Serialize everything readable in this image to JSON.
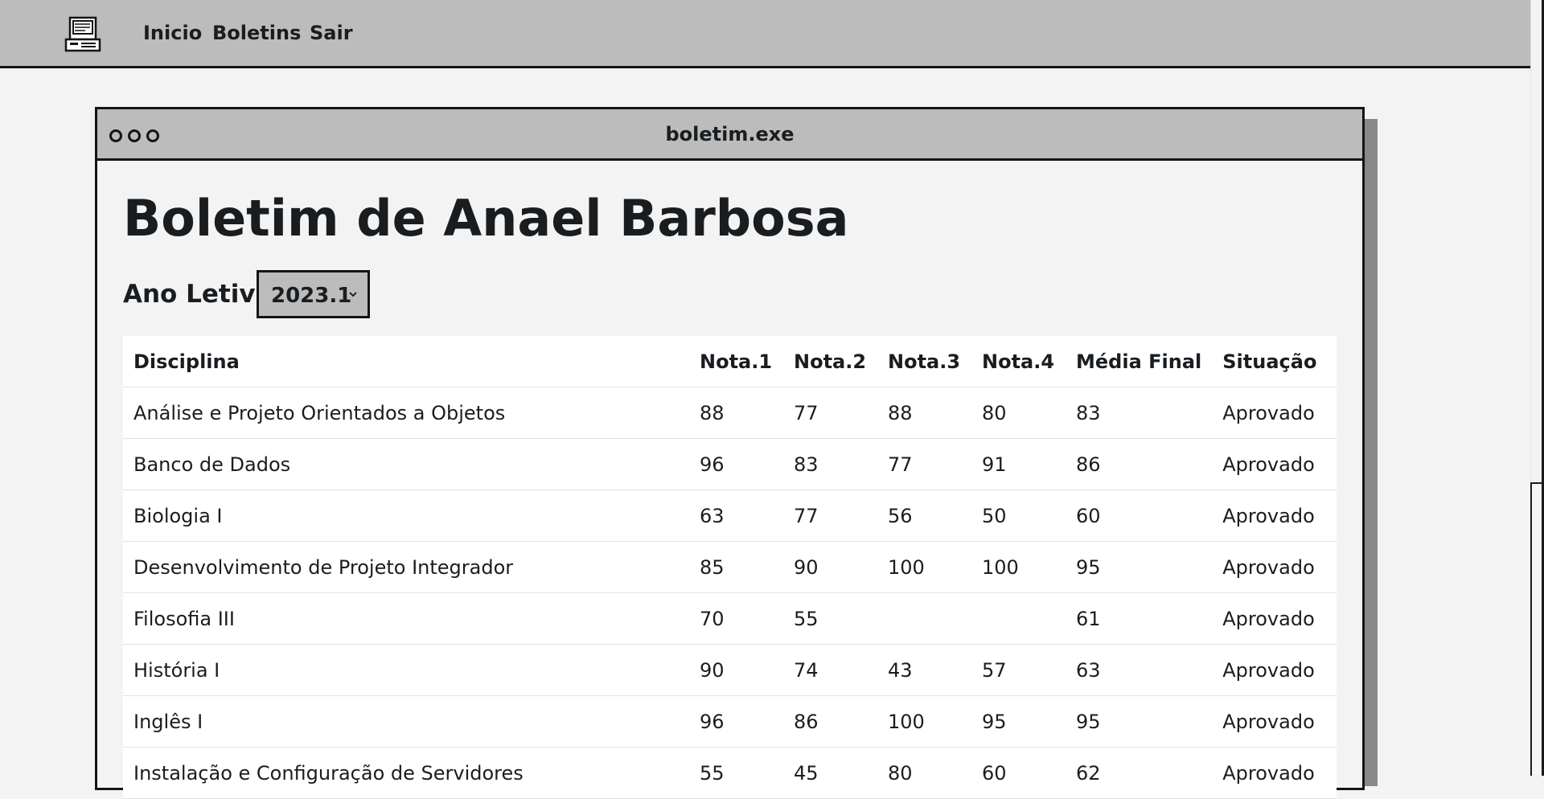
{
  "navbar": {
    "logo_icon": "retro-computer-icon",
    "links": [
      "Inicio",
      "Boletins",
      "Sair"
    ]
  },
  "window": {
    "title": "boletim.exe",
    "controls": [
      "circle-icon",
      "circle-icon",
      "circle-icon"
    ]
  },
  "page": {
    "heading": "Boletim de Anael Barbosa",
    "year_label": "Ano Letivo",
    "year_selected": "2023.1"
  },
  "table": {
    "headers": [
      "Disciplina",
      "Nota.1",
      "Nota.2",
      "Nota.3",
      "Nota.4",
      "Média Final",
      "Situação"
    ],
    "rows": [
      [
        "Análise e Projeto Orientados a Objetos",
        "88",
        "77",
        "88",
        "80",
        "83",
        "Aprovado"
      ],
      [
        "Banco de Dados",
        "96",
        "83",
        "77",
        "91",
        "86",
        "Aprovado"
      ],
      [
        "Biologia I",
        "63",
        "77",
        "56",
        "50",
        "60",
        "Aprovado"
      ],
      [
        "Desenvolvimento de Projeto Integrador",
        "85",
        "90",
        "100",
        "100",
        "95",
        "Aprovado"
      ],
      [
        "Filosofia III",
        "70",
        "55",
        "",
        "",
        "61",
        "Aprovado"
      ],
      [
        "História I",
        "90",
        "74",
        "43",
        "57",
        "63",
        "Aprovado"
      ],
      [
        "Inglês I",
        "96",
        "86",
        "100",
        "95",
        "95",
        "Aprovado"
      ],
      [
        "Instalação e Configuração de Servidores",
        "55",
        "45",
        "80",
        "60",
        "62",
        "Aprovado"
      ]
    ]
  },
  "colors": {
    "background": "#f3f3f3",
    "bar_gray": "#bbbcbb",
    "border": "#141414",
    "shadow": "#888888",
    "table_bg": "#ffffff",
    "text": "#1a1d20"
  }
}
